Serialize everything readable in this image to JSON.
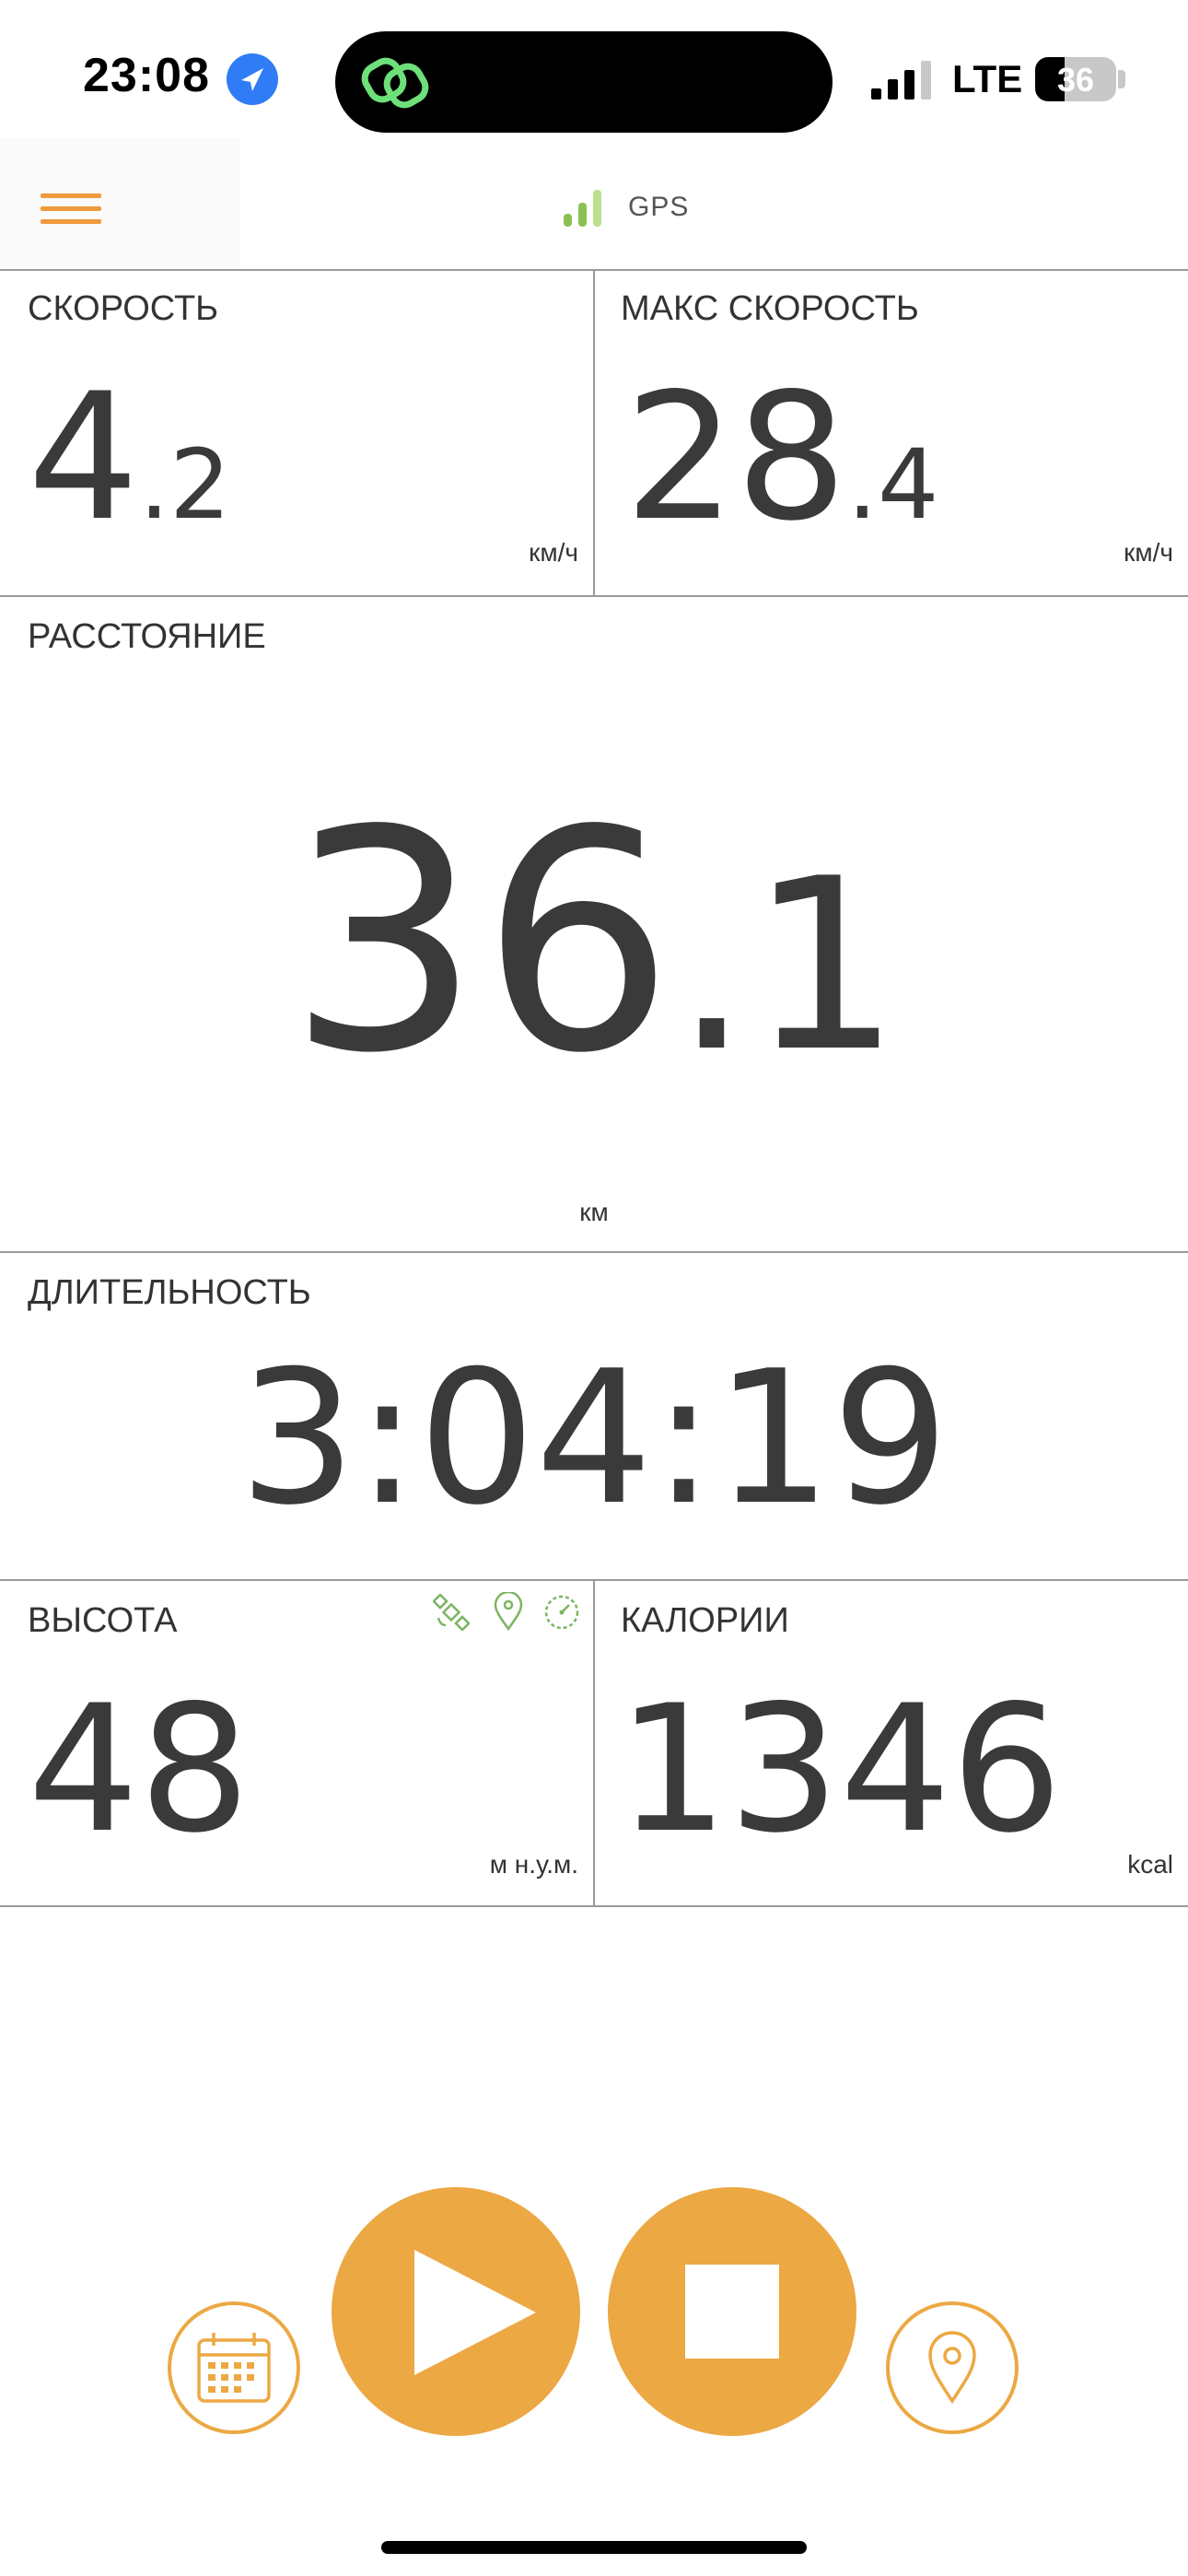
{
  "status_bar": {
    "time": "23:08",
    "network": "LTE",
    "battery_level": "36",
    "battery_fraction": 0.36,
    "location_icon": "location-arrow-icon",
    "app_icon": "linked-rings-icon"
  },
  "app_bar": {
    "menu_icon": "hamburger-menu-icon",
    "gps_label": "GPS",
    "gps_icon": "signal-bars-icon"
  },
  "tiles": {
    "speed": {
      "label": "СКОРОСТЬ",
      "int": "4",
      "frac": ".2",
      "unit": "км/ч"
    },
    "max_speed": {
      "label": "МАКС СКОРОСТЬ",
      "int": "28",
      "frac": ".4",
      "unit": "км/ч"
    },
    "distance": {
      "label": "РАССТОЯНИЕ",
      "int": "36",
      "frac": ".1",
      "unit": "км"
    },
    "duration": {
      "label": "ДЛИТЕЛЬНОСТЬ",
      "value": "3:04:19"
    },
    "altitude": {
      "label": "ВЫСОТА",
      "value": "48",
      "unit": "м н.у.м.",
      "icons": [
        "satellite-icon",
        "map-pin-icon",
        "gauge-icon"
      ]
    },
    "calories": {
      "label": "КАЛОРИИ",
      "value": "1346",
      "unit": "kcal"
    }
  },
  "controls": {
    "calendar": "calendar-icon",
    "play": "play-icon",
    "stop": "stop-icon",
    "location": "location-pin-icon"
  },
  "colors": {
    "accent": "#eca843",
    "menu": "#ef9a3c",
    "gps_green": "#8cc152",
    "divider": "#9a9a9a",
    "text": "#3a3a3a"
  }
}
